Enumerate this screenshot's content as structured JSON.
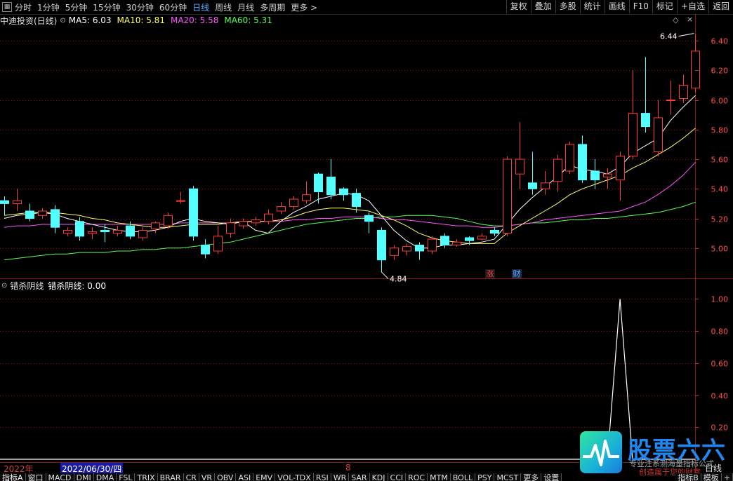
{
  "toolbar": {
    "menu_icon": "grid-menu-icon",
    "periods": [
      "分时",
      "1分钟",
      "5分钟",
      "15分钟",
      "30分钟",
      "60分钟",
      "日线",
      "周线",
      "月线",
      "多周期",
      "更多 >"
    ],
    "active_period": "日线",
    "right_buttons": [
      "复权",
      "叠加",
      "多股",
      "统计",
      "画线",
      "F10",
      "标记",
      "+自选",
      "返回"
    ]
  },
  "main_chart": {
    "title": "中迪投资(日线)",
    "ma_labels": [
      {
        "text": "MA5: 6.03",
        "color": "#ffffff"
      },
      {
        "text": "MA10: 5.81",
        "color": "#ffff66"
      },
      {
        "text": "MA20: 5.58",
        "color": "#ff55ff"
      },
      {
        "text": "MA60: 5.31",
        "color": "#55ff55"
      }
    ],
    "high_label": "6.44",
    "low_label": "4.84",
    "marker_zhang": "涨",
    "marker_cai": "财"
  },
  "sub_chart": {
    "title": "错杀阴线",
    "value_label": "错杀阴线: 0.00"
  },
  "date_bar": {
    "year": "2022年",
    "cursor_date": "2022/06/30/四",
    "month": "8"
  },
  "bottom_tabs": [
    "指标A",
    "窗口",
    "MACD",
    "DMI",
    "DMA",
    "FSL",
    "TRIX",
    "BRAR",
    "CR",
    "VR",
    "OBV",
    "ASI",
    "EMV",
    "VOL-TDX",
    "RSI",
    "WR",
    "SAR",
    "KDJ",
    "CCI",
    "ROC",
    "MTM",
    "BOLL",
    "PSY",
    "MCST",
    "更多",
    "设置"
  ],
  "bottom_right_tabs": [
    "指标B",
    "模板",
    "+"
  ],
  "right_side_label": "日线",
  "logo": {
    "title": "股票六六",
    "slogan": "专业注系测海量指标公式",
    "slogan2": "创造属于您的财富"
  },
  "colors": {
    "up": "#ff3c3c",
    "down": "#54ffff",
    "grid": "#8a1a1a"
  },
  "chart_data": [
    {
      "type": "candlestick",
      "title": "中迪投资(日线)",
      "ylim": [
        4.8,
        6.5
      ],
      "yticks": [
        5.0,
        5.2,
        5.4,
        5.6,
        5.8,
        6.0,
        6.2,
        6.4
      ],
      "candles": [
        [
          5.32,
          5.35,
          5.3,
          5.22
        ],
        [
          5.3,
          5.4,
          5.32,
          5.25
        ],
        [
          5.25,
          5.3,
          5.2,
          5.18
        ],
        [
          5.22,
          5.27,
          5.25,
          5.2
        ],
        [
          5.26,
          5.29,
          5.14,
          5.1
        ],
        [
          5.1,
          5.14,
          5.12,
          5.08
        ],
        [
          5.18,
          5.21,
          5.08,
          5.05
        ],
        [
          5.1,
          5.14,
          5.11,
          5.06
        ],
        [
          5.12,
          5.16,
          5.11,
          5.04
        ],
        [
          5.1,
          5.15,
          5.12,
          5.08
        ],
        [
          5.15,
          5.18,
          5.08,
          5.06
        ],
        [
          5.07,
          5.14,
          5.12,
          5.05
        ],
        [
          5.13,
          5.18,
          5.17,
          5.1
        ],
        [
          5.15,
          5.24,
          5.22,
          5.13
        ],
        [
          5.32,
          5.38,
          5.32,
          5.3
        ],
        [
          5.4,
          5.42,
          5.08,
          5.05
        ],
        [
          5.02,
          5.06,
          4.96,
          4.93
        ],
        [
          4.98,
          5.15,
          5.08,
          4.96
        ],
        [
          5.1,
          5.2,
          5.17,
          5.07
        ],
        [
          5.15,
          5.2,
          5.18,
          5.13
        ],
        [
          5.17,
          5.21,
          5.19,
          5.15
        ],
        [
          5.18,
          5.26,
          5.23,
          5.16
        ],
        [
          5.25,
          5.31,
          5.28,
          5.23
        ],
        [
          5.28,
          5.35,
          5.33,
          5.26
        ],
        [
          5.32,
          5.45,
          5.36,
          5.3
        ],
        [
          5.5,
          5.51,
          5.38,
          5.3
        ],
        [
          5.48,
          5.6,
          5.36,
          5.33
        ],
        [
          5.4,
          5.41,
          5.36,
          5.32
        ],
        [
          5.37,
          5.4,
          5.28,
          5.24
        ],
        [
          5.22,
          5.24,
          5.18,
          5.1
        ],
        [
          5.12,
          5.14,
          4.92,
          4.84
        ],
        [
          4.95,
          5.02,
          5.0,
          4.92
        ],
        [
          4.98,
          5.03,
          5.01,
          4.95
        ],
        [
          5.02,
          5.04,
          4.98,
          4.92
        ],
        [
          4.98,
          5.08,
          5.06,
          4.96
        ],
        [
          5.08,
          5.1,
          5.02,
          5.0
        ],
        [
          5.02,
          5.06,
          5.04,
          5.01
        ],
        [
          5.07,
          5.08,
          5.05,
          5.02
        ],
        [
          5.06,
          5.1,
          5.08,
          5.05
        ],
        [
          5.12,
          5.14,
          5.1,
          5.08
        ],
        [
          5.1,
          5.62,
          5.6,
          5.08
        ],
        [
          5.5,
          5.85,
          5.6,
          5.4
        ],
        [
          5.44,
          5.65,
          5.4,
          5.36
        ],
        [
          5.4,
          5.52,
          5.44,
          5.36
        ],
        [
          5.45,
          5.63,
          5.6,
          5.38
        ],
        [
          5.52,
          5.72,
          5.7,
          5.5
        ],
        [
          5.7,
          5.76,
          5.46,
          5.44
        ],
        [
          5.52,
          5.6,
          5.46,
          5.4
        ],
        [
          5.48,
          5.54,
          5.5,
          5.4
        ],
        [
          5.46,
          5.65,
          5.62,
          5.32
        ],
        [
          5.62,
          6.2,
          5.91,
          5.6
        ],
        [
          5.91,
          6.29,
          5.82,
          5.78
        ],
        [
          5.65,
          6.0,
          5.88,
          5.62
        ],
        [
          6.0,
          6.13,
          6.0,
          5.9
        ],
        [
          6.01,
          6.17,
          6.1,
          5.98
        ],
        [
          6.08,
          6.44,
          6.33,
          6.05
        ]
      ],
      "ma5": [
        5.2,
        5.22,
        5.23,
        5.24,
        5.23,
        5.2,
        5.18,
        5.16,
        5.14,
        5.12,
        5.11,
        5.11,
        5.12,
        5.14,
        5.18,
        5.2,
        5.18,
        5.17,
        5.16,
        5.18,
        5.12,
        5.1,
        5.18,
        5.24,
        5.28,
        5.33,
        5.35,
        5.37,
        5.36,
        5.32,
        5.22,
        5.12,
        5.05,
        5.0,
        5.0,
        5.02,
        5.02,
        5.03,
        5.04,
        5.06,
        5.16,
        5.26,
        5.34,
        5.41,
        5.48,
        5.56,
        5.53,
        5.52,
        5.5,
        5.55,
        5.64,
        5.69,
        5.74,
        5.86,
        5.95,
        6.03
      ],
      "ma10": [
        5.22,
        5.23,
        5.24,
        5.24,
        5.24,
        5.23,
        5.22,
        5.2,
        5.19,
        5.17,
        5.16,
        5.15,
        5.14,
        5.14,
        5.15,
        5.16,
        5.16,
        5.16,
        5.17,
        5.18,
        5.18,
        5.18,
        5.19,
        5.21,
        5.24,
        5.26,
        5.27,
        5.27,
        5.26,
        5.25,
        5.22,
        5.19,
        5.15,
        5.1,
        5.07,
        5.05,
        5.04,
        5.03,
        5.03,
        5.03,
        5.1,
        5.15,
        5.2,
        5.25,
        5.3,
        5.36,
        5.4,
        5.43,
        5.46,
        5.49,
        5.54,
        5.58,
        5.63,
        5.68,
        5.74,
        5.81
      ],
      "ma20": [
        5.14,
        5.15,
        5.15,
        5.16,
        5.16,
        5.16,
        5.16,
        5.16,
        5.16,
        5.16,
        5.16,
        5.16,
        5.16,
        5.16,
        5.17,
        5.17,
        5.17,
        5.17,
        5.17,
        5.18,
        5.18,
        5.18,
        5.18,
        5.19,
        5.19,
        5.2,
        5.2,
        5.21,
        5.21,
        5.21,
        5.2,
        5.19,
        5.19,
        5.18,
        5.17,
        5.16,
        5.15,
        5.15,
        5.14,
        5.14,
        5.15,
        5.16,
        5.17,
        5.19,
        5.2,
        5.21,
        5.22,
        5.23,
        5.24,
        5.25,
        5.28,
        5.31,
        5.36,
        5.42,
        5.49,
        5.58
      ],
      "ma60": [
        4.92,
        4.93,
        4.94,
        4.95,
        4.96,
        4.96,
        4.97,
        4.97,
        4.97,
        4.98,
        4.98,
        4.99,
        4.99,
        5.0,
        5.0,
        5.01,
        5.02,
        5.03,
        5.04,
        5.06,
        5.08,
        5.1,
        5.12,
        5.14,
        5.16,
        5.17,
        5.18,
        5.19,
        5.2,
        5.2,
        5.21,
        5.21,
        5.22,
        5.22,
        5.22,
        5.21,
        5.2,
        5.18,
        5.16,
        5.15,
        5.15,
        5.16,
        5.17,
        5.17,
        5.18,
        5.19,
        5.19,
        5.2,
        5.2,
        5.21,
        5.22,
        5.23,
        5.24,
        5.26,
        5.28,
        5.31
      ]
    },
    {
      "type": "line",
      "title": "错杀阴线",
      "ylim": [
        0,
        1.05
      ],
      "yticks": [
        0.2,
        0.4,
        0.6,
        0.8,
        1.0
      ],
      "values": [
        0,
        0,
        0,
        0,
        0,
        0,
        0,
        0,
        0,
        0,
        0,
        0,
        0,
        0,
        0,
        0,
        0,
        0,
        0,
        0,
        0,
        0,
        0,
        0,
        0,
        0,
        0,
        0,
        0,
        0,
        0,
        0,
        0,
        0,
        0,
        0,
        0,
        0,
        0,
        0,
        0,
        0,
        0,
        0,
        0,
        0,
        0,
        0,
        0,
        1,
        0,
        0,
        0,
        0,
        0,
        0
      ]
    }
  ]
}
